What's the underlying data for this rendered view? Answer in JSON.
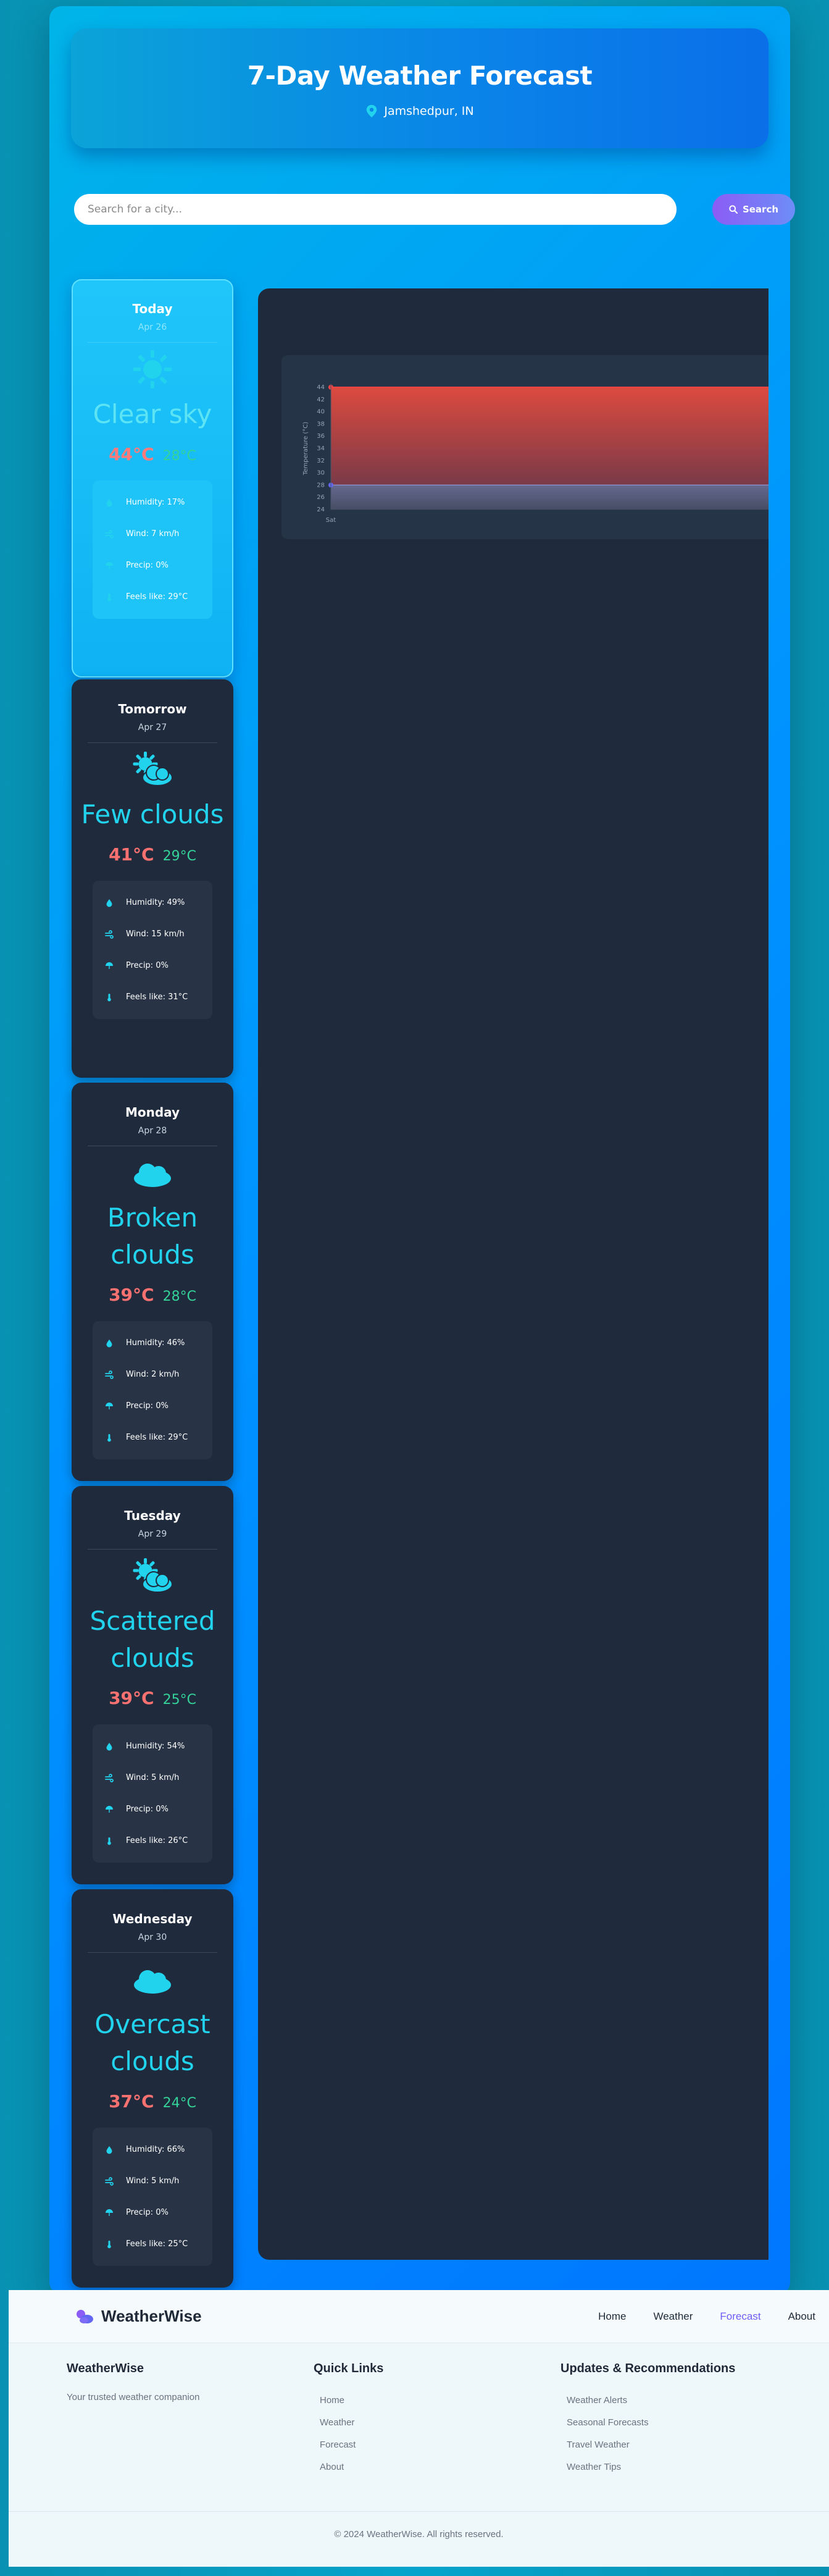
{
  "header": {
    "title": "7-Day Weather Forecast",
    "location": "Jamshedpur, IN"
  },
  "search": {
    "placeholder": "Search for a city...",
    "button_label": "Search"
  },
  "days": [
    {
      "name": "Today",
      "date": "Apr 26",
      "icon": "sun-icon",
      "description": "Clear sky",
      "max": "44°C",
      "min": "28°C",
      "humidity": "Humidity: 17%",
      "wind": "Wind: 7 km/h",
      "precip": "Precip: 0%",
      "feels": "Feels like: 29°C"
    },
    {
      "name": "Tomorrow",
      "date": "Apr 27",
      "icon": "sun-cloud-icon",
      "description": "Few clouds",
      "max": "41°C",
      "min": "29°C",
      "humidity": "Humidity: 49%",
      "wind": "Wind: 15 km/h",
      "precip": "Precip: 0%",
      "feels": "Feels like: 31°C"
    },
    {
      "name": "Monday",
      "date": "Apr 28",
      "icon": "cloud-icon",
      "description": "Broken clouds",
      "max": "39°C",
      "min": "28°C",
      "humidity": "Humidity: 46%",
      "wind": "Wind: 2 km/h",
      "precip": "Precip: 0%",
      "feels": "Feels like: 29°C"
    },
    {
      "name": "Tuesday",
      "date": "Apr 29",
      "icon": "sun-cloud-icon",
      "description": "Scattered clouds",
      "max": "39°C",
      "min": "25°C",
      "humidity": "Humidity: 54%",
      "wind": "Wind: 5 km/h",
      "precip": "Precip: 0%",
      "feels": "Feels like: 26°C"
    },
    {
      "name": "Wednesday",
      "date": "Apr 30",
      "icon": "cloud-icon",
      "description": "Overcast clouds",
      "max": "37°C",
      "min": "24°C",
      "humidity": "Humidity: 66%",
      "wind": "Wind: 5 km/h",
      "precip": "Precip: 0%",
      "feels": "Feels like: 25°C"
    }
  ],
  "chart_data": {
    "type": "area",
    "categories": [
      "Sat"
    ],
    "series": [
      {
        "values": [
          44
        ],
        "color": "#ef4444"
      },
      {
        "values": [
          28
        ],
        "color": "#6366f1"
      }
    ],
    "ylabel": "Temperature (°C)",
    "yticks": [
      "44",
      "42",
      "40",
      "38",
      "36",
      "34",
      "32",
      "30",
      "28",
      "26",
      "24"
    ],
    "ylim": [
      24,
      44
    ],
    "grid": true
  },
  "footer": {
    "brand": "WeatherWise",
    "nav": [
      "Home",
      "Weather",
      "Forecast",
      "About"
    ],
    "active_nav": "Forecast",
    "about_title": "WeatherWise",
    "about_text": "Your trusted weather companion",
    "quick_title": "Quick Links",
    "quick_links": [
      "Home",
      "Weather",
      "Forecast",
      "About"
    ],
    "updates_title": "Updates & Recommendations",
    "updates_links": [
      "Weather Alerts",
      "Seasonal Forecasts",
      "Travel Weather",
      "Weather Tips"
    ],
    "copyright": "© 2024 WeatherWise. All rights reserved."
  },
  "colors": {
    "accent": "#22d3ee",
    "max_temp": "#f87171",
    "min_temp": "#34d399",
    "button": "#8b5cf6"
  }
}
